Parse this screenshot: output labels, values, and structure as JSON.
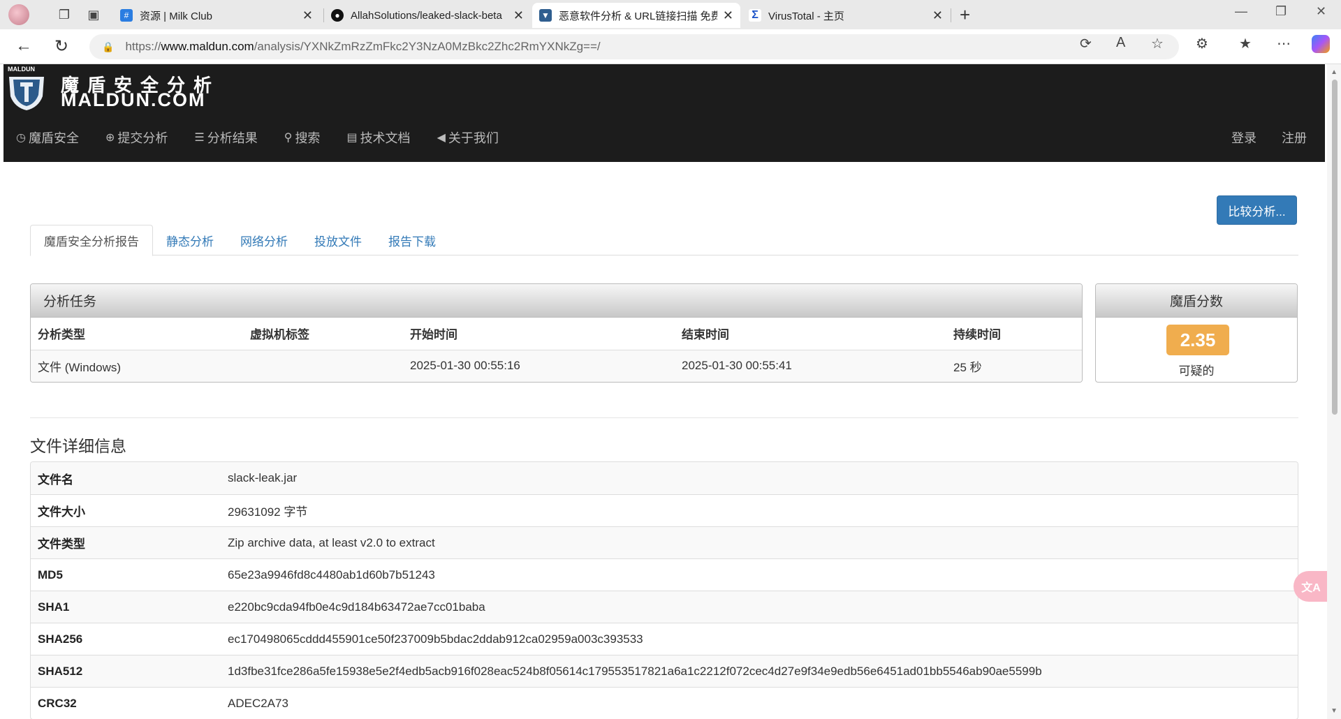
{
  "browser": {
    "tabs": [
      {
        "title": "资源 | Milk Club",
        "favicon": "milk-club-icon",
        "active": false
      },
      {
        "title": "AllahSolutions/leaked-slack-beta",
        "favicon": "github-icon",
        "active": false
      },
      {
        "title": "恶意软件分析 & URL链接扫描 免费",
        "favicon": "maldun-icon",
        "active": true
      },
      {
        "title": "VirusTotal - 主页",
        "favicon": "virustotal-icon",
        "active": false
      }
    ],
    "url": {
      "prefix": "https://",
      "host": "www.maldun.com",
      "path": "/analysis/YXNkZmRzZmFkc2Y3NzA0MzBkc2Zhc2RmYXNkZg==/"
    }
  },
  "site": {
    "logo_cn": "魔盾安全分析",
    "logo_en": "MALDUN.COM",
    "logo_badge": "MALDUN",
    "nav": [
      {
        "label": "魔盾安全",
        "icon": "clock-icon"
      },
      {
        "label": "提交分析",
        "icon": "upload-icon"
      },
      {
        "label": "分析结果",
        "icon": "list-icon"
      },
      {
        "label": "搜索",
        "icon": "search-icon"
      },
      {
        "label": "技术文档",
        "icon": "file-icon"
      },
      {
        "label": "关于我们",
        "icon": "bullhorn-icon"
      }
    ],
    "login": "登录",
    "register": "注册"
  },
  "compare_button": "比较分析...",
  "page_tabs": [
    "魔盾安全分析报告",
    "静态分析",
    "网络分析",
    "投放文件",
    "报告下载"
  ],
  "task_panel": {
    "title": "分析任务",
    "headers": [
      "分析类型",
      "虚拟机标签",
      "开始时间",
      "结束时间",
      "持续时间"
    ],
    "row": [
      "文件 (Windows)",
      "",
      "2025-01-30 00:55:16",
      "2025-01-30 00:55:41",
      "25 秒"
    ]
  },
  "score_panel": {
    "title": "魔盾分数",
    "score": "2.35",
    "label": "可疑的",
    "badge_color": "#f0ad4e"
  },
  "file_details": {
    "title": "文件详细信息",
    "rows": [
      {
        "key": "文件名",
        "value": "slack-leak.jar"
      },
      {
        "key": "文件大小",
        "value": "29631092 字节"
      },
      {
        "key": "文件类型",
        "value": "Zip archive data, at least v2.0 to extract"
      },
      {
        "key": "MD5",
        "value": "65e23a9946fd8c4480ab1d60b7b51243"
      },
      {
        "key": "SHA1",
        "value": "e220bc9cda94fb0e4c9d184b63472ae7cc01baba"
      },
      {
        "key": "SHA256",
        "value": "ec170498065cddd455901ce50f237009b5bdac2ddab912ca02959a003c393533"
      },
      {
        "key": "SHA512",
        "value": "1d3fbe31fce286a5fe15938e5e2f4edb5acb916f028eac524b8f05614c179553517821a6a1c2212f072cec4d27e9f34e9edb56e6451ad01bb5546ab90ae5599b"
      },
      {
        "key": "CRC32",
        "value": "ADEC2A73"
      }
    ]
  },
  "translate_widget": "文A"
}
